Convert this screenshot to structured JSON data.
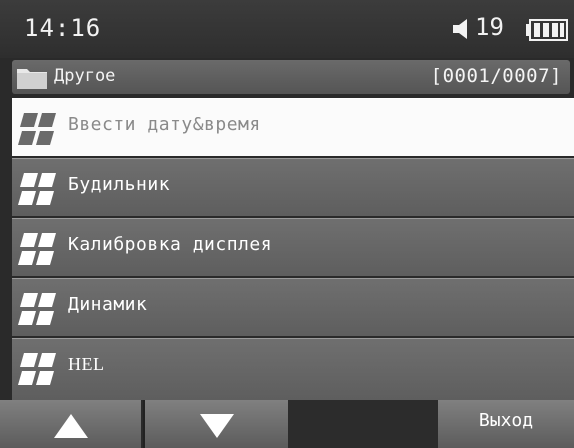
{
  "status_bar": {
    "time": "14:16",
    "volume": "19",
    "speaker_icon": "speaker-icon",
    "battery_icon": "battery-icon"
  },
  "folder": {
    "icon": "folder-icon",
    "name": "Другое",
    "counter": "[0001/0007]"
  },
  "menu": {
    "items": [
      {
        "label": "Ввести дату&время",
        "icon": "settings-grid-icon",
        "selected": true
      },
      {
        "label": "Будильник",
        "icon": "settings-grid-icon",
        "selected": false
      },
      {
        "label": "Калибровка дисплея",
        "icon": "settings-grid-icon",
        "selected": false
      },
      {
        "label": "Динамик",
        "icon": "settings-grid-icon",
        "selected": false
      },
      {
        "label": "HEL",
        "icon": "settings-grid-icon",
        "selected": false
      }
    ]
  },
  "softkeys": {
    "up_icon": "arrow-up-icon",
    "down_icon": "arrow-down-icon",
    "exit_label": "Выход"
  },
  "colors": {
    "selected_background": "#fbfbfb",
    "item_background": "#666666",
    "text": "#ffffff"
  }
}
